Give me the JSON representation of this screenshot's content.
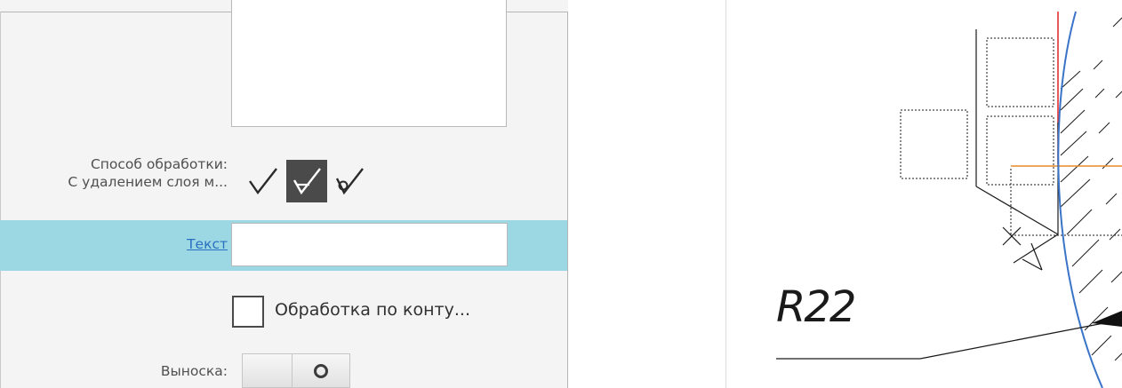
{
  "panel": {
    "method_label": "Способ обработки:",
    "method_value": "С удалением слоя м...",
    "method_buttons": [
      {
        "icon": "roughness-basic-icon"
      },
      {
        "icon": "roughness-removal-icon",
        "selected": true
      },
      {
        "icon": "roughness-no-removal-icon"
      }
    ],
    "text_link": "Текст",
    "text_value": "",
    "contour_checkbox_label": "Обработка по конту...",
    "leader_label": "Выноска:"
  },
  "drawing": {
    "dimension_text": "R22",
    "colors": {
      "arc": "#3a74c8",
      "red_axis": "#e02424",
      "orange_axis": "#e88a2a",
      "lines": "#000000",
      "selected_row": "#9bd8e4",
      "selected_button": "#4a4a4a"
    }
  }
}
